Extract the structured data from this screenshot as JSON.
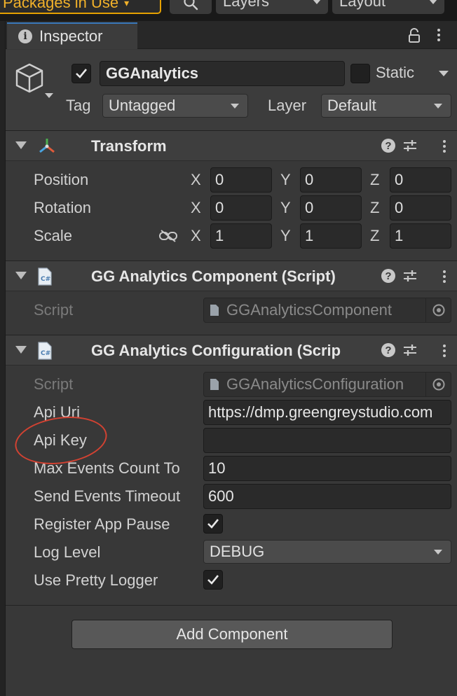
{
  "toolbar": {
    "packages_label": "Packages in Use",
    "layers_label": "Layers",
    "layout_label": "Layout"
  },
  "inspector": {
    "tab_label": "Inspector",
    "object": {
      "name": "GGAnalytics",
      "active": true,
      "static_label": "Static",
      "static": false,
      "tag_label": "Tag",
      "tag_value": "Untagged",
      "layer_label": "Layer",
      "layer_value": "Default"
    },
    "transform": {
      "title": "Transform",
      "position": {
        "label": "Position",
        "x": "0",
        "y": "0",
        "z": "0"
      },
      "rotation": {
        "label": "Rotation",
        "x": "0",
        "y": "0",
        "z": "0"
      },
      "scale": {
        "label": "Scale",
        "x": "1",
        "y": "1",
        "z": "1"
      },
      "axis_x": "X",
      "axis_y": "Y",
      "axis_z": "Z"
    },
    "component": {
      "title": "GG Analytics Component (Script)",
      "script_label": "Script",
      "script_value": "GGAnalyticsComponent"
    },
    "configuration": {
      "title": "GG Analytics Configuration (Scrip",
      "script_label": "Script",
      "script_value": "GGAnalyticsConfiguration",
      "api_uri_label": "Api Uri",
      "api_uri_value": "https://dmp.greengreystudio.com",
      "api_key_label": "Api Key",
      "api_key_value": "",
      "max_events_label": "Max Events Count To",
      "max_events_value": "10",
      "send_timeout_label": "Send Events Timeout",
      "send_timeout_value": "600",
      "register_pause_label": "Register App Pause",
      "register_pause": true,
      "log_level_label": "Log Level",
      "log_level_value": "DEBUG",
      "pretty_logger_label": "Use Pretty Logger",
      "pretty_logger": true
    },
    "add_component_label": "Add Component"
  },
  "colors": {
    "annotation": "#d24232",
    "tab_accent": "#3a79bb",
    "packages_accent": "#e6a100"
  }
}
